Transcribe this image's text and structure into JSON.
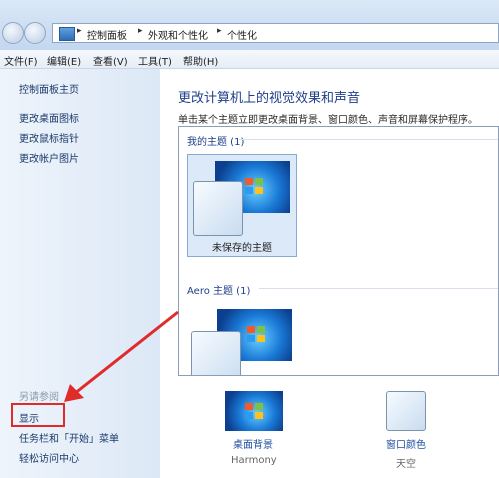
{
  "address": {
    "crumbs": [
      "控制面板",
      "外观和个性化",
      "个性化"
    ],
    "nav_separator": "▸"
  },
  "menu": [
    "文件(F)",
    "编辑(E)",
    "查看(V)",
    "工具(T)",
    "帮助(H)"
  ],
  "sidebar": {
    "home": "控制面板主页",
    "links": [
      "更改桌面图标",
      "更改鼠标指针",
      "更改帐户图片"
    ],
    "see_also": "另请参阅",
    "see_also_links": [
      "显示",
      "任务栏和「开始」菜单",
      "轻松访问中心"
    ]
  },
  "main": {
    "title": "更改计算机上的视觉效果和声音",
    "subtitle": "单击某个主题立即更改桌面背景、窗口颜色、声音和屏幕保护程序。",
    "my_themes_header": "我的主题 (1)",
    "unsaved_theme": "未保存的主题",
    "aero_header": "Aero 主题 (1)"
  },
  "tiles": {
    "desktop_bg_label": "桌面背景",
    "desktop_bg_value": "Harmony",
    "window_color_label": "窗口颜色",
    "window_color_value": "天空"
  },
  "colors": {
    "annotation_red": "#e12b2b",
    "link_blue": "#1f4fa0"
  }
}
